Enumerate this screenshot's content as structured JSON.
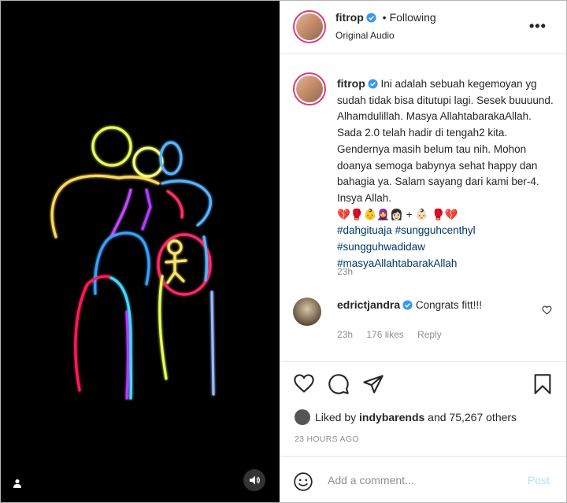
{
  "header": {
    "username": "fitrop",
    "dot": "•",
    "follow_status": "Following",
    "audio": "Original Audio",
    "more": "•••"
  },
  "caption": {
    "username": "fitrop",
    "text": "Ini adalah sebuah kegemoyan yg sudah tidak bisa ditutupi lagi. Sesek buuuund. Alhamdulillah. Masya AllahtabarakaAllah. Sada 2.0 telah hadir di tengah2 kita. Gendernya masih belum tau nih. Mohon doanya semoga babynya sehat happy dan bahagia ya. Salam sayang dari kami ber-4. Insya Allah.",
    "emojis": "💔🥊👶🧕👩🏻 + 👶🏻 🥊💔",
    "hashtags": [
      "#dahgituaja #sungguhcenthyl",
      "#sungguhwadidaw",
      "#masyaAllahtabarakAllah"
    ],
    "time": "23h"
  },
  "comment": {
    "username": "edrictjandra",
    "text": "Congrats fitt!!!",
    "time": "23h",
    "likes": "176 likes",
    "reply": "Reply"
  },
  "likes": {
    "prefix": "Liked by ",
    "user": "indybarends",
    "suffix": " and 75,267 others"
  },
  "timestamp": "23 HOURS AGO",
  "add_comment": {
    "placeholder": "Add a comment...",
    "post": "Post"
  },
  "colors": {
    "verified": "#3897f0",
    "link": "#00376b",
    "muted": "#8e8e8e",
    "post_disabled": "#b2dffc",
    "story_ring": "#e23a7a"
  }
}
